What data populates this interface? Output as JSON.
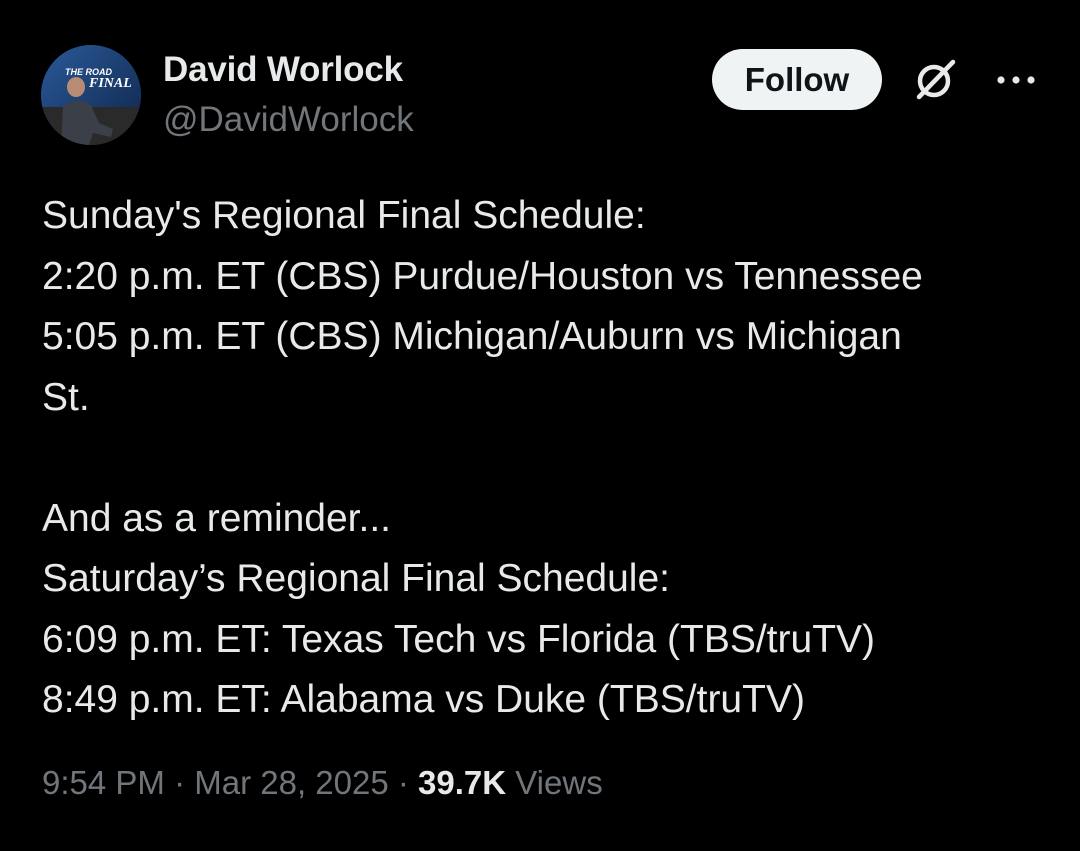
{
  "author": {
    "display_name": "David Worlock",
    "handle": "@DavidWorlock",
    "avatar_text_top": "THE ROAD",
    "avatar_text_bottom": "FINAL"
  },
  "actions": {
    "follow_label": "Follow",
    "grok_icon": "grok-icon",
    "more_icon": "more-icon"
  },
  "tweet": {
    "lines": [
      "Sunday's Regional Final Schedule:",
      "2:20 p.m. ET (CBS) Purdue/Houston vs Tennessee",
      "5:05 p.m. ET (CBS) Michigan/Auburn vs Michigan",
      "St.",
      "",
      "And as a reminder...",
      "Saturday’s Regional Final Schedule:",
      "6:09 p.m. ET: Texas Tech vs Florida (TBS/truTV)",
      "8:49 p.m. ET: Alabama vs Duke (TBS/truTV)"
    ]
  },
  "meta": {
    "time": "9:54 PM",
    "separator": " · ",
    "date": "Mar 28, 2025",
    "views_count": "39.7K",
    "views_label": "Views"
  },
  "colors": {
    "background": "#000000",
    "primary_text": "#e7e9ea",
    "secondary_text": "#71767b",
    "follow_bg": "#eff3f4",
    "follow_text": "#0f1419"
  }
}
